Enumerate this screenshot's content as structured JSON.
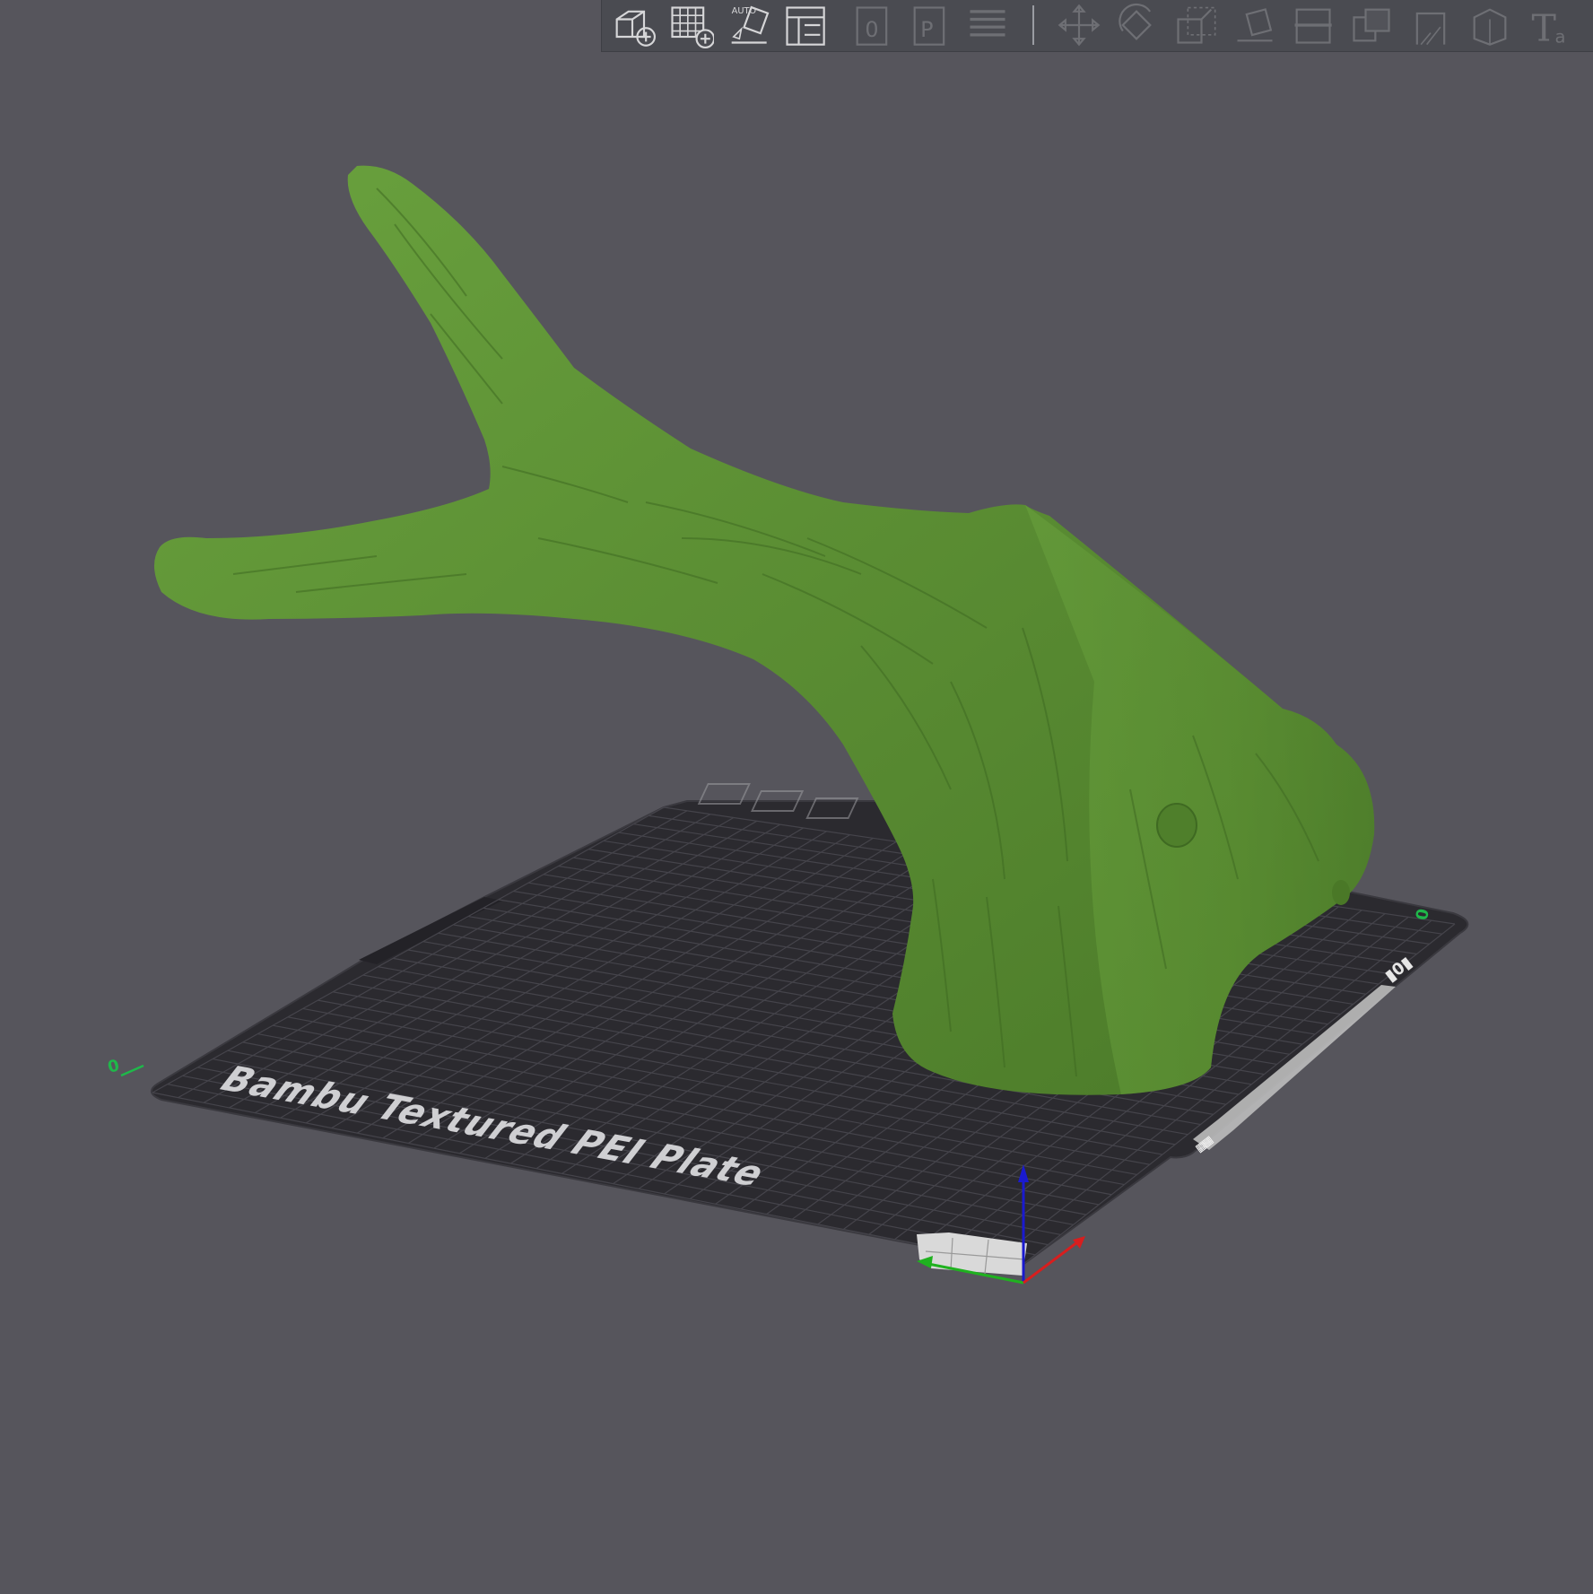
{
  "plate": {
    "name": "Bambu Textured PEI Plate",
    "axis_label_x_end": "0",
    "axis_label_y_end": "0"
  },
  "toolbar": {
    "auto_label": "AUTO",
    "separator_index": 7,
    "buttons": [
      {
        "id": "add",
        "icon": "add-object-icon",
        "enabled": true
      },
      {
        "id": "add-plate",
        "icon": "add-plate-icon",
        "enabled": true
      },
      {
        "id": "auto-orient",
        "icon": "auto-orient-icon",
        "enabled": true
      },
      {
        "id": "arrange",
        "icon": "arrange-icon",
        "enabled": true
      },
      {
        "id": "paint-0",
        "icon": "object-0-icon",
        "enabled": false
      },
      {
        "id": "plate-p",
        "icon": "plate-p-icon",
        "enabled": false
      },
      {
        "id": "layers",
        "icon": "layers-icon",
        "enabled": false
      },
      {
        "id": "move",
        "icon": "move-icon",
        "enabled": false
      },
      {
        "id": "rotate",
        "icon": "rotate-icon",
        "enabled": false
      },
      {
        "id": "scale",
        "icon": "scale-icon",
        "enabled": false
      },
      {
        "id": "lay-on-face",
        "icon": "lay-on-face-icon",
        "enabled": false
      },
      {
        "id": "cut",
        "icon": "cut-icon",
        "enabled": false
      },
      {
        "id": "boolean",
        "icon": "boolean-icon",
        "enabled": false
      },
      {
        "id": "support-paint",
        "icon": "support-paint-icon",
        "enabled": false
      },
      {
        "id": "seam-paint",
        "icon": "seam-paint-icon",
        "enabled": false
      },
      {
        "id": "text",
        "icon": "text-icon",
        "enabled": false
      }
    ]
  },
  "colors": {
    "background": "#56555c",
    "toolbar": "#4a4b51",
    "plate": "#2b2a2f",
    "grid": "#44434a",
    "model": "#5e9234",
    "axis_x": "#d81e1e",
    "axis_y": "#1fb21f",
    "axis_z": "#1a1acf",
    "plate_marker": "#1fb84a"
  }
}
